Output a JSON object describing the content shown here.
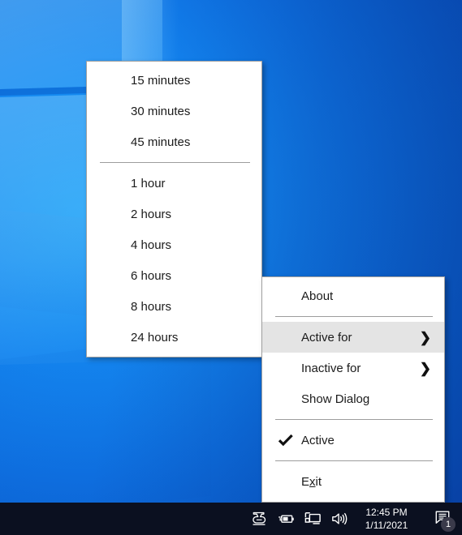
{
  "desktop": {
    "wallpaper_name": "windows-10-hero-wallpaper",
    "colors": {
      "light_blue": "#1a9ef5",
      "mid_blue": "#0e6fe0",
      "dark_blue": "#0946ad",
      "taskbar": "#0b1020"
    }
  },
  "submenu_durations": {
    "name": "active-for-durations",
    "groups": [
      {
        "items": [
          {
            "label": "15 minutes"
          },
          {
            "label": "30 minutes"
          },
          {
            "label": "45 minutes"
          }
        ]
      },
      {
        "items": [
          {
            "label": "1 hour"
          },
          {
            "label": "2 hours"
          },
          {
            "label": "4 hours"
          },
          {
            "label": "6 hours"
          },
          {
            "label": "8 hours"
          },
          {
            "label": "24 hours"
          }
        ]
      }
    ]
  },
  "tray_menu": {
    "name": "tray-context-menu",
    "items": [
      {
        "label": "About",
        "type": "item",
        "highlight": false,
        "arrow": "",
        "checked": false
      },
      {
        "type": "separator"
      },
      {
        "label": "Active for",
        "type": "item",
        "highlight": true,
        "arrow": "❯",
        "checked": false
      },
      {
        "label": "Inactive for",
        "type": "item",
        "highlight": false,
        "arrow": "❯",
        "checked": false
      },
      {
        "label": "Show Dialog",
        "type": "item",
        "highlight": false,
        "arrow": "",
        "checked": false
      },
      {
        "type": "separator"
      },
      {
        "label": "Active",
        "type": "item",
        "highlight": false,
        "arrow": "",
        "checked": true
      },
      {
        "type": "separator"
      },
      {
        "label": "Exit",
        "type": "item",
        "highlight": false,
        "arrow": "",
        "checked": false,
        "accelerator_index": 1
      }
    ],
    "highlight_color": "#e4e4e4",
    "checkmark_glyph": "✔"
  },
  "taskbar": {
    "icons": [
      {
        "name": "coffee-pot-icon"
      },
      {
        "name": "battery-icon"
      },
      {
        "name": "network-display-icon"
      },
      {
        "name": "volume-icon"
      }
    ],
    "clock": {
      "time": "12:45 PM",
      "date": "1/11/2021"
    },
    "notifications": {
      "icon": "notification-center-icon",
      "badge_count": "1"
    }
  }
}
